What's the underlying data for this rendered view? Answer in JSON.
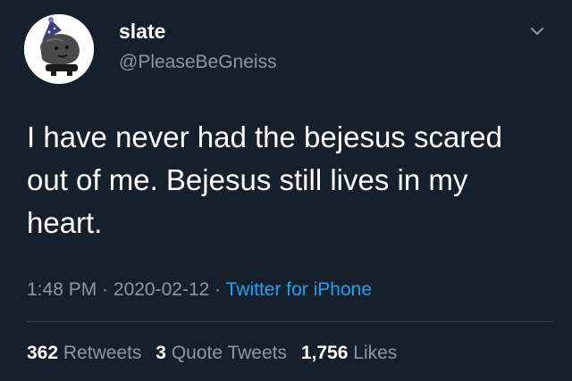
{
  "user": {
    "display_name": "slate",
    "handle": "@PleaseBeGneiss",
    "avatar_icon": "party-rock-avatar"
  },
  "tweet": {
    "text": "I have never had the bejesus scared\nout of me. Bejesus still lives in my\nheart.",
    "time": "1:48 PM",
    "sep1": " · ",
    "date": "2020-02-12",
    "sep2": " · ",
    "source": "Twitter for iPhone"
  },
  "stats": {
    "retweets": "362",
    "retweets_label": "Retweets",
    "quotes": "3",
    "quotes_label": "Quote Tweets",
    "likes": "1,756",
    "likes_label": "Likes"
  },
  "colors": {
    "background": "#15202b",
    "secondary_text": "#8899a6",
    "link": "#1da1f2"
  }
}
